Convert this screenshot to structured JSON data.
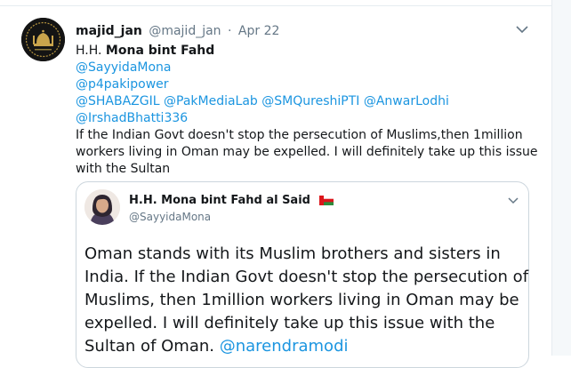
{
  "tweet": {
    "author_name": "majid_jan",
    "author_handle": "@majid_jan",
    "separator": "·",
    "date": "Apr 22",
    "title_prefix": "H.H.",
    "title_name": "Mona bint Fahd",
    "mentions_line1": "@SayyidaMona",
    "mentions_line2": "@p4pakipower",
    "mentions_line3": [
      "@SHABAZGIL",
      "@PakMediaLab",
      "@SMQureshiPTI",
      "@AnwarLodhi"
    ],
    "mentions_line4": "@IrshadBhatti336",
    "text_lines": [
      "If the Indian Govt doesn't stop the persecution of Muslims,then 1million",
      "workers living in Oman may be expelled. I will definitely take up this issue",
      "with the Sultan"
    ]
  },
  "quoted": {
    "name": "H.H. Mona bint Fahd al Said",
    "flag": "oman-flag-icon",
    "handle": "@SayyidaMona",
    "text_lines": [
      "Oman stands with its Muslim brothers and sisters in",
      "India. If the Indian Govt doesn't stop the persecution of",
      "Muslims, then 1million workers living in Oman may be",
      "expelled. I will definitely take up this issue with the"
    ],
    "last_line_text": "Sultan of Oman.",
    "last_line_mention": "@narendramodi"
  },
  "colors": {
    "link": "#1b95e0",
    "text": "#14171a",
    "muted": "#657786",
    "border": "#ccd6dd"
  }
}
